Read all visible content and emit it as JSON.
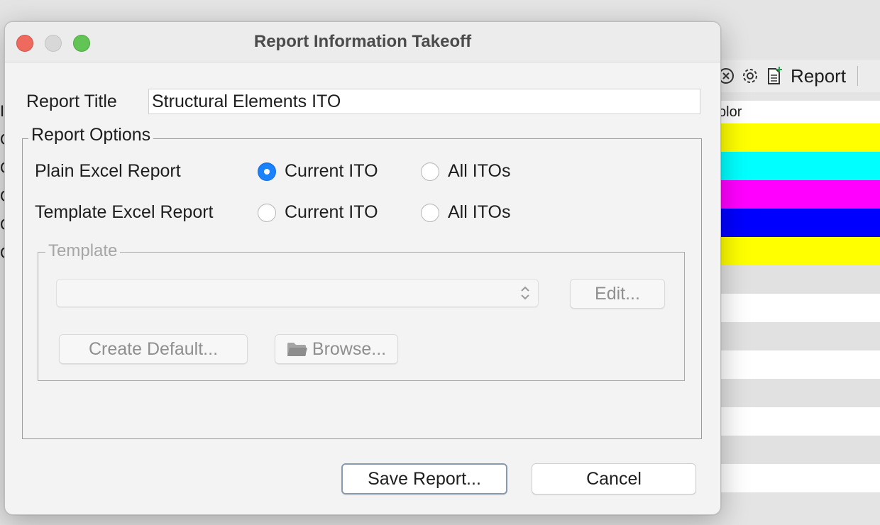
{
  "dialog": {
    "window_title": "Report Information Takeoff",
    "report_title_label": "Report Title",
    "report_title_value": "Structural Elements ITO",
    "report_options": {
      "legend": "Report Options",
      "rows": [
        {
          "label": "Plain Excel Report",
          "options": [
            {
              "label": "Current ITO",
              "checked": true
            },
            {
              "label": "All ITOs",
              "checked": false
            }
          ]
        },
        {
          "label": "Template Excel Report",
          "options": [
            {
              "label": "Current ITO",
              "checked": false
            },
            {
              "label": "All ITOs",
              "checked": false
            }
          ]
        }
      ]
    },
    "template": {
      "legend": "Template",
      "selected_value": "",
      "edit_label": "Edit...",
      "create_default_label": "Create Default...",
      "browse_label": "Browse...",
      "enabled": false
    },
    "buttons": {
      "save_label": "Save Report...",
      "cancel_label": "Cancel"
    }
  },
  "background": {
    "toolbar_report_label": "Report",
    "column_header_fragment": "olor",
    "color_rows": [
      "#ffff00",
      "#00ffff",
      "#ff00ff",
      "#0000ff",
      "#ffff00"
    ],
    "left_fragments": [
      "I",
      "C",
      "C",
      "C",
      "C",
      "C"
    ],
    "stripe_rows": [
      "#e1e1e1",
      "#ffffff",
      "#e1e1e1",
      "#ffffff",
      "#e1e1e1",
      "#ffffff",
      "#e1e1e1",
      "#ffffff"
    ]
  },
  "colors": {
    "accent_blue": "#1a82fb",
    "close_red": "#ee6a5f",
    "maximize_green": "#61c454"
  }
}
